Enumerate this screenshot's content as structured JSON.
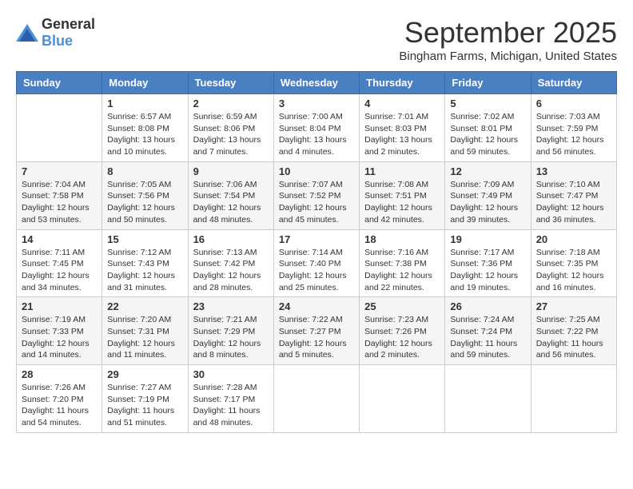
{
  "logo": {
    "general": "General",
    "blue": "Blue"
  },
  "title": "September 2025",
  "location": "Bingham Farms, Michigan, United States",
  "days_of_week": [
    "Sunday",
    "Monday",
    "Tuesday",
    "Wednesday",
    "Thursday",
    "Friday",
    "Saturday"
  ],
  "weeks": [
    [
      {
        "day": "",
        "sunrise": "",
        "sunset": "",
        "daylight": ""
      },
      {
        "day": "1",
        "sunrise": "Sunrise: 6:57 AM",
        "sunset": "Sunset: 8:08 PM",
        "daylight": "Daylight: 13 hours and 10 minutes."
      },
      {
        "day": "2",
        "sunrise": "Sunrise: 6:59 AM",
        "sunset": "Sunset: 8:06 PM",
        "daylight": "Daylight: 13 hours and 7 minutes."
      },
      {
        "day": "3",
        "sunrise": "Sunrise: 7:00 AM",
        "sunset": "Sunset: 8:04 PM",
        "daylight": "Daylight: 13 hours and 4 minutes."
      },
      {
        "day": "4",
        "sunrise": "Sunrise: 7:01 AM",
        "sunset": "Sunset: 8:03 PM",
        "daylight": "Daylight: 13 hours and 2 minutes."
      },
      {
        "day": "5",
        "sunrise": "Sunrise: 7:02 AM",
        "sunset": "Sunset: 8:01 PM",
        "daylight": "Daylight: 12 hours and 59 minutes."
      },
      {
        "day": "6",
        "sunrise": "Sunrise: 7:03 AM",
        "sunset": "Sunset: 7:59 PM",
        "daylight": "Daylight: 12 hours and 56 minutes."
      }
    ],
    [
      {
        "day": "7",
        "sunrise": "Sunrise: 7:04 AM",
        "sunset": "Sunset: 7:58 PM",
        "daylight": "Daylight: 12 hours and 53 minutes."
      },
      {
        "day": "8",
        "sunrise": "Sunrise: 7:05 AM",
        "sunset": "Sunset: 7:56 PM",
        "daylight": "Daylight: 12 hours and 50 minutes."
      },
      {
        "day": "9",
        "sunrise": "Sunrise: 7:06 AM",
        "sunset": "Sunset: 7:54 PM",
        "daylight": "Daylight: 12 hours and 48 minutes."
      },
      {
        "day": "10",
        "sunrise": "Sunrise: 7:07 AM",
        "sunset": "Sunset: 7:52 PM",
        "daylight": "Daylight: 12 hours and 45 minutes."
      },
      {
        "day": "11",
        "sunrise": "Sunrise: 7:08 AM",
        "sunset": "Sunset: 7:51 PM",
        "daylight": "Daylight: 12 hours and 42 minutes."
      },
      {
        "day": "12",
        "sunrise": "Sunrise: 7:09 AM",
        "sunset": "Sunset: 7:49 PM",
        "daylight": "Daylight: 12 hours and 39 minutes."
      },
      {
        "day": "13",
        "sunrise": "Sunrise: 7:10 AM",
        "sunset": "Sunset: 7:47 PM",
        "daylight": "Daylight: 12 hours and 36 minutes."
      }
    ],
    [
      {
        "day": "14",
        "sunrise": "Sunrise: 7:11 AM",
        "sunset": "Sunset: 7:45 PM",
        "daylight": "Daylight: 12 hours and 34 minutes."
      },
      {
        "day": "15",
        "sunrise": "Sunrise: 7:12 AM",
        "sunset": "Sunset: 7:43 PM",
        "daylight": "Daylight: 12 hours and 31 minutes."
      },
      {
        "day": "16",
        "sunrise": "Sunrise: 7:13 AM",
        "sunset": "Sunset: 7:42 PM",
        "daylight": "Daylight: 12 hours and 28 minutes."
      },
      {
        "day": "17",
        "sunrise": "Sunrise: 7:14 AM",
        "sunset": "Sunset: 7:40 PM",
        "daylight": "Daylight: 12 hours and 25 minutes."
      },
      {
        "day": "18",
        "sunrise": "Sunrise: 7:16 AM",
        "sunset": "Sunset: 7:38 PM",
        "daylight": "Daylight: 12 hours and 22 minutes."
      },
      {
        "day": "19",
        "sunrise": "Sunrise: 7:17 AM",
        "sunset": "Sunset: 7:36 PM",
        "daylight": "Daylight: 12 hours and 19 minutes."
      },
      {
        "day": "20",
        "sunrise": "Sunrise: 7:18 AM",
        "sunset": "Sunset: 7:35 PM",
        "daylight": "Daylight: 12 hours and 16 minutes."
      }
    ],
    [
      {
        "day": "21",
        "sunrise": "Sunrise: 7:19 AM",
        "sunset": "Sunset: 7:33 PM",
        "daylight": "Daylight: 12 hours and 14 minutes."
      },
      {
        "day": "22",
        "sunrise": "Sunrise: 7:20 AM",
        "sunset": "Sunset: 7:31 PM",
        "daylight": "Daylight: 12 hours and 11 minutes."
      },
      {
        "day": "23",
        "sunrise": "Sunrise: 7:21 AM",
        "sunset": "Sunset: 7:29 PM",
        "daylight": "Daylight: 12 hours and 8 minutes."
      },
      {
        "day": "24",
        "sunrise": "Sunrise: 7:22 AM",
        "sunset": "Sunset: 7:27 PM",
        "daylight": "Daylight: 12 hours and 5 minutes."
      },
      {
        "day": "25",
        "sunrise": "Sunrise: 7:23 AM",
        "sunset": "Sunset: 7:26 PM",
        "daylight": "Daylight: 12 hours and 2 minutes."
      },
      {
        "day": "26",
        "sunrise": "Sunrise: 7:24 AM",
        "sunset": "Sunset: 7:24 PM",
        "daylight": "Daylight: 11 hours and 59 minutes."
      },
      {
        "day": "27",
        "sunrise": "Sunrise: 7:25 AM",
        "sunset": "Sunset: 7:22 PM",
        "daylight": "Daylight: 11 hours and 56 minutes."
      }
    ],
    [
      {
        "day": "28",
        "sunrise": "Sunrise: 7:26 AM",
        "sunset": "Sunset: 7:20 PM",
        "daylight": "Daylight: 11 hours and 54 minutes."
      },
      {
        "day": "29",
        "sunrise": "Sunrise: 7:27 AM",
        "sunset": "Sunset: 7:19 PM",
        "daylight": "Daylight: 11 hours and 51 minutes."
      },
      {
        "day": "30",
        "sunrise": "Sunrise: 7:28 AM",
        "sunset": "Sunset: 7:17 PM",
        "daylight": "Daylight: 11 hours and 48 minutes."
      },
      {
        "day": "",
        "sunrise": "",
        "sunset": "",
        "daylight": ""
      },
      {
        "day": "",
        "sunrise": "",
        "sunset": "",
        "daylight": ""
      },
      {
        "day": "",
        "sunrise": "",
        "sunset": "",
        "daylight": ""
      },
      {
        "day": "",
        "sunrise": "",
        "sunset": "",
        "daylight": ""
      }
    ]
  ]
}
